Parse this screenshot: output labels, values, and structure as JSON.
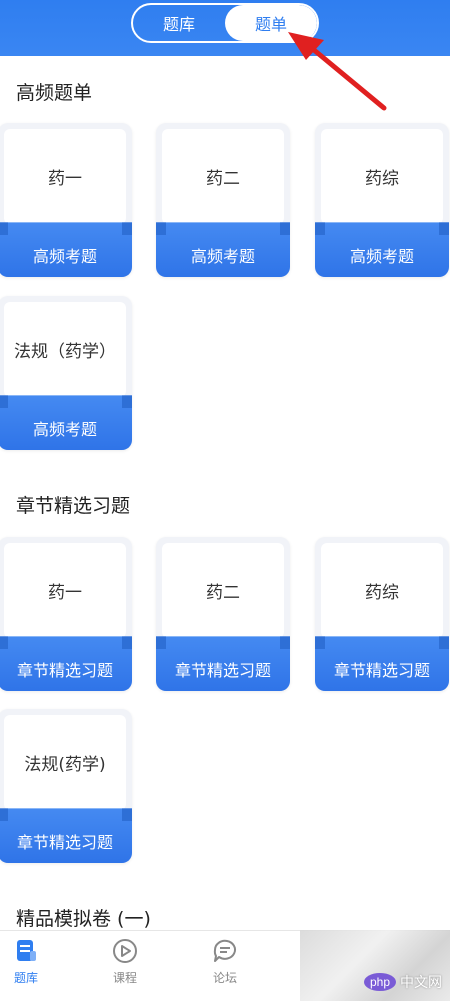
{
  "header": {
    "tabs": [
      {
        "label": "题库",
        "active": false
      },
      {
        "label": "题单",
        "active": true
      }
    ]
  },
  "sections": [
    {
      "title": "高频题单",
      "cards": [
        {
          "subject": "药一",
          "label": "高频考题"
        },
        {
          "subject": "药二",
          "label": "高频考题"
        },
        {
          "subject": "药综",
          "label": "高频考题"
        },
        {
          "subject": "法规（药学）",
          "label": "高频考题"
        }
      ]
    },
    {
      "title": "章节精选习题",
      "cards": [
        {
          "subject": "药一",
          "label": "章节精选习题"
        },
        {
          "subject": "药二",
          "label": "章节精选习题"
        },
        {
          "subject": "药综",
          "label": "章节精选习题"
        },
        {
          "subject": "法规(药学)",
          "label": "章节精选习题"
        }
      ]
    },
    {
      "title": "精品模拟卷 (一)",
      "cards": []
    }
  ],
  "bottom_nav": {
    "items": [
      {
        "label": "题库",
        "icon": "document-icon",
        "active": true
      },
      {
        "label": "课程",
        "icon": "play-circle-icon",
        "active": false
      },
      {
        "label": "论坛",
        "icon": "chat-bubble-icon",
        "active": false
      }
    ]
  },
  "watermark": {
    "logo": "php",
    "text": "中文网"
  },
  "colors": {
    "accent": "#2f7ef0",
    "arrow": "#e02020"
  }
}
